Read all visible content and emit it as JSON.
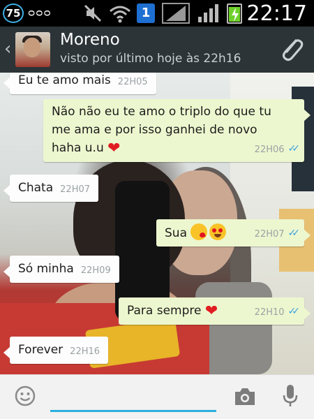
{
  "status_bar": {
    "badge_count": "75",
    "notification_glyphs": "ᴑᴑᴑ",
    "sim_number": "1",
    "time": "22:17"
  },
  "header": {
    "contact_name": "Moreno",
    "last_seen": "visto por último hoje às 22h16",
    "icons": [
      "back-chevron-icon",
      "avatar",
      "paperclip-icon"
    ]
  },
  "messages": [
    {
      "direction": "in",
      "text": "Eu te amo mais",
      "time": "22H05"
    },
    {
      "direction": "out",
      "lines": [
        "Não não eu te amo o triplo do que tu",
        "me ama e por isso ganhei de novo",
        "haha u.u"
      ],
      "emoji": "heart",
      "time": "22H06",
      "status": "read"
    },
    {
      "direction": "in",
      "text": "Chata",
      "time": "22H07"
    },
    {
      "direction": "out",
      "text": "Sua",
      "emoji": "kiss-face hearteyes-face",
      "time": "22H07",
      "status": "read"
    },
    {
      "direction": "in",
      "text": "Só minha",
      "time": "22H09"
    },
    {
      "direction": "out",
      "text": "Para sempre",
      "emoji": "heart",
      "time": "22H10",
      "status": "read"
    },
    {
      "direction": "in",
      "text": "Forever",
      "time": "22H16"
    }
  ],
  "input_bar": {
    "placeholder": "",
    "icons": [
      "smiley-icon",
      "camera-icon",
      "microphone-icon"
    ]
  },
  "colors": {
    "action_bar": "#2c3437",
    "outgoing_bubble": "#edf7cf",
    "incoming_bubble": "#fdfdfd",
    "read_ticks": "#39a1e0",
    "input_underline": "#2cb0de"
  }
}
